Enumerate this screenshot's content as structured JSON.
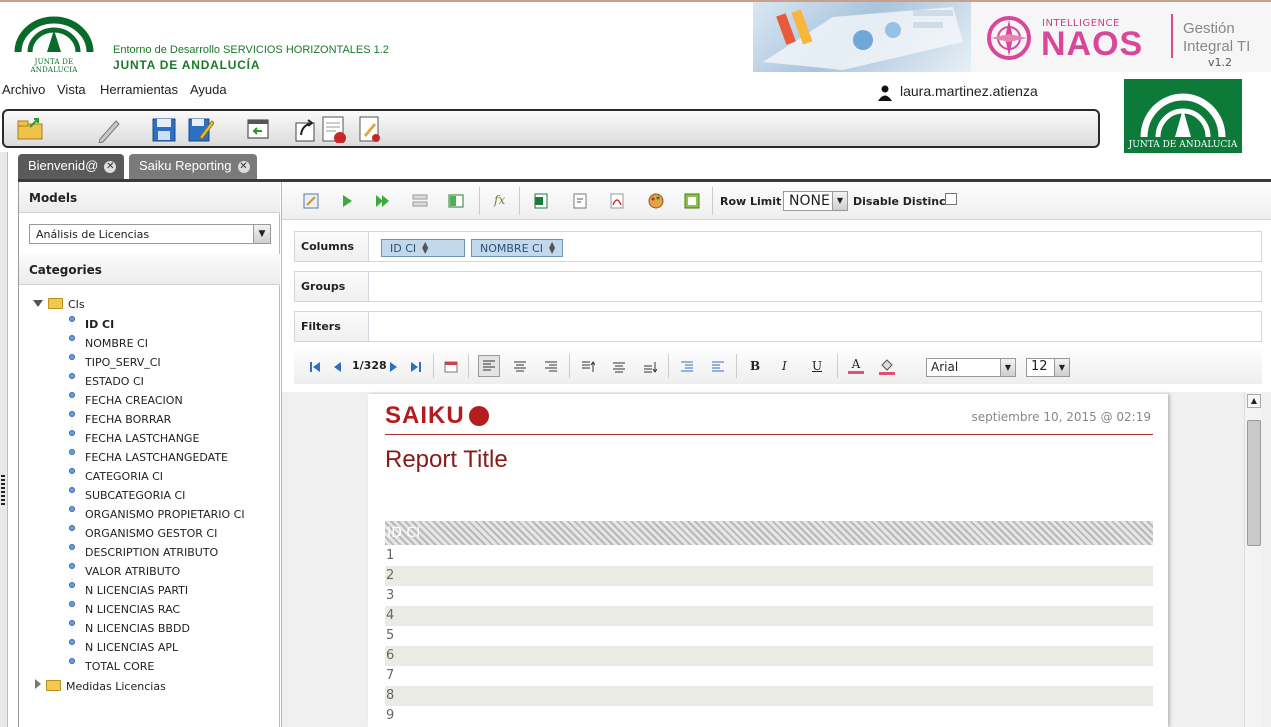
{
  "header": {
    "env_title": "Entorno de Desarrollo SERVICIOS HORIZONTALES 1.2",
    "org_name": "JUNTA DE ANDALUCÍA",
    "logo_text": "JUNTA DE ANDALUCIA",
    "naos": {
      "intelligence": "INTELLIGENCE",
      "name": "NAOS",
      "gestion": "Gestión",
      "integral": "Integral TI",
      "version": "v1.2"
    }
  },
  "menu": [
    "Archivo",
    "Vista",
    "Herramientas",
    "Ayuda"
  ],
  "user": {
    "name": "laura.martinez.atienza"
  },
  "right_logo_text": "JUNTA DE ANDALUCIA",
  "tabs": [
    {
      "label": "Bienvenid@",
      "active": false
    },
    {
      "label": "Saiku Reporting",
      "active": true
    }
  ],
  "left_panel": {
    "models_label": "Models",
    "model_selected": "Análisis de Licencias",
    "categories_label": "Categories",
    "folder_cis": "CIs",
    "fields": [
      "ID CI",
      "NOMBRE CI",
      "TIPO_SERV_CI",
      "ESTADO CI",
      "FECHA CREACION",
      "FECHA BORRAR",
      "FECHA LASTCHANGE",
      "FECHA LASTCHANGEDATE",
      "CATEGORIA CI",
      "SUBCATEGORIA CI",
      "ORGANISMO PROPIETARIO CI",
      "ORGANISMO GESTOR CI",
      "DESCRIPTION ATRIBUTO",
      "VALOR ATRIBUTO",
      "N LICENCIAS PARTI",
      "N LICENCIAS RAC",
      "N LICENCIAS BBDD",
      "N LICENCIAS APL",
      "TOTAL CORE"
    ],
    "folder_medidas": "Medidas Licencias"
  },
  "query_toolbar": {
    "row_limit_label": "Row Limit",
    "row_limit_value": "NONE",
    "disable_distinct_label": "Disable Distinct"
  },
  "axes": {
    "columns_label": "Columns",
    "columns": [
      "ID CI",
      "NOMBRE CI"
    ],
    "groups_label": "Groups",
    "filters_label": "Filters"
  },
  "report_toolbar": {
    "page": "1/328",
    "font": "Arial",
    "size": "12"
  },
  "report": {
    "logo": "SAIKU",
    "date": "septiembre 10, 2015 @ 02:19",
    "title": "Report Title",
    "column_header": "ID CI",
    "rows": [
      "1",
      "2",
      "3",
      "4",
      "5",
      "6",
      "7",
      "8",
      "9"
    ]
  },
  "colors": {
    "jda_green": "#0d7a3a",
    "naos_pink": "#d9479a",
    "saiku_red": "#b31d1d",
    "pill_bg": "#c2d9ec"
  }
}
